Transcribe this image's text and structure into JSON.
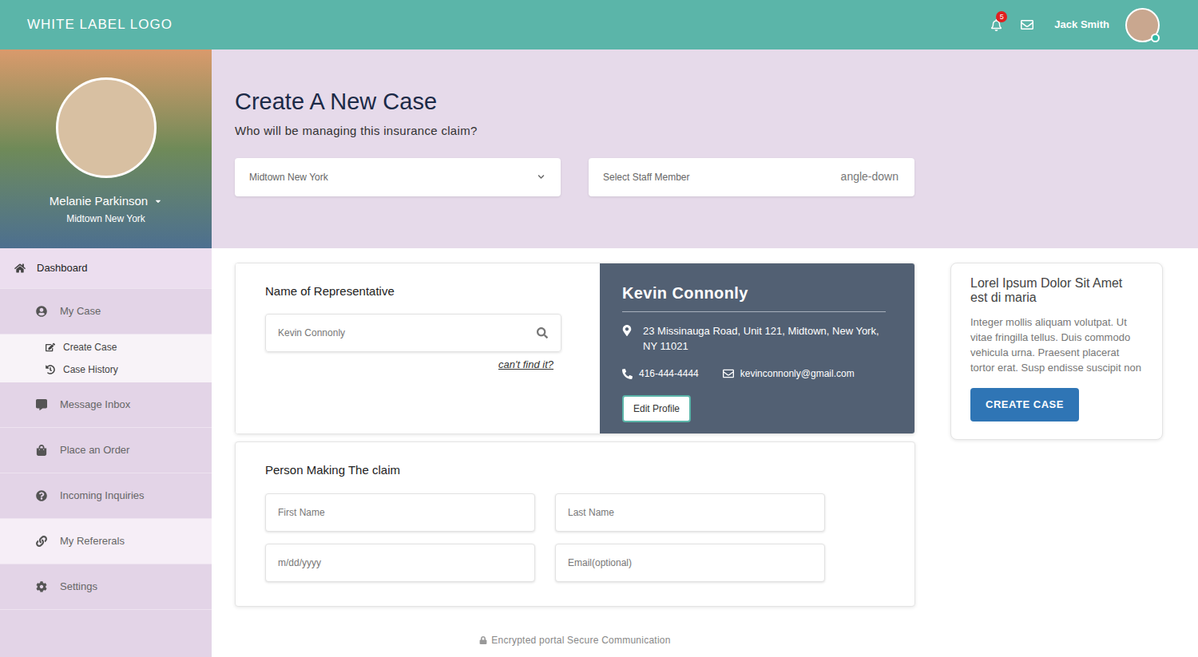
{
  "header": {
    "logo": "WHITE LABEL LOGO",
    "notifications": {
      "count": "5"
    },
    "user": {
      "name": "Jack Smith",
      "online": true
    }
  },
  "profile": {
    "name": "Melanie Parkinson",
    "location": "Midtown New York"
  },
  "sidebar": {
    "items": [
      {
        "label": "Dashboard",
        "selected": true,
        "highlighted": false,
        "children": []
      },
      {
        "label": "My Case",
        "selected": false,
        "highlighted": false,
        "children": [
          {
            "label": "Create Case"
          },
          {
            "label": "Case History"
          }
        ]
      },
      {
        "label": "Message Inbox",
        "selected": false,
        "highlighted": false,
        "children": []
      },
      {
        "label": "Place an Order",
        "selected": false,
        "highlighted": false,
        "children": []
      },
      {
        "label": "Incoming Inquiries",
        "selected": false,
        "highlighted": false,
        "children": []
      },
      {
        "label": "My Refererals",
        "selected": false,
        "highlighted": true,
        "children": []
      },
      {
        "label": "Settings",
        "selected": false,
        "highlighted": false,
        "children": []
      }
    ]
  },
  "page": {
    "title": "Create A New Case",
    "subtitle": "Who will be managing this insurance claim?",
    "selects": [
      {
        "value": "Midtown New York",
        "kind": "chevron",
        "icon_text": ""
      },
      {
        "value": "Select Staff Member",
        "kind": "text",
        "icon_text": "angle-down"
      }
    ]
  },
  "representative": {
    "label": "Name of Representative",
    "search_placeholder": "Kevin Connonly",
    "link": "can't find it?"
  },
  "contact_card": {
    "name": "Kevin Connonly",
    "address": "23 Missinauga Road, Unit 121, Midtown, New York, NY 11021",
    "phone": "416-444-4444",
    "email": "kevinconnonly@gmail.com",
    "button": "Edit Profile"
  },
  "claimant": {
    "title": "Person Making The claim",
    "fields": [
      {
        "placeholder": "First Name"
      },
      {
        "placeholder": "Last Name"
      },
      {
        "placeholder": "m/dd/yyyy"
      },
      {
        "placeholder": "Email(optional)"
      }
    ]
  },
  "aside": {
    "title": "Lorel Ipsum Dolor Sit Amet est di maria",
    "body": "Integer mollis aliquam volutpat. Ut vitae fringilla tellus. Duis commodo vehicula urna. Praesent placerat tortor erat. Susp endisse suscipit non",
    "button": "CREATE CASE"
  },
  "footer": {
    "text": "Encrypted portal Secure Communication"
  }
}
